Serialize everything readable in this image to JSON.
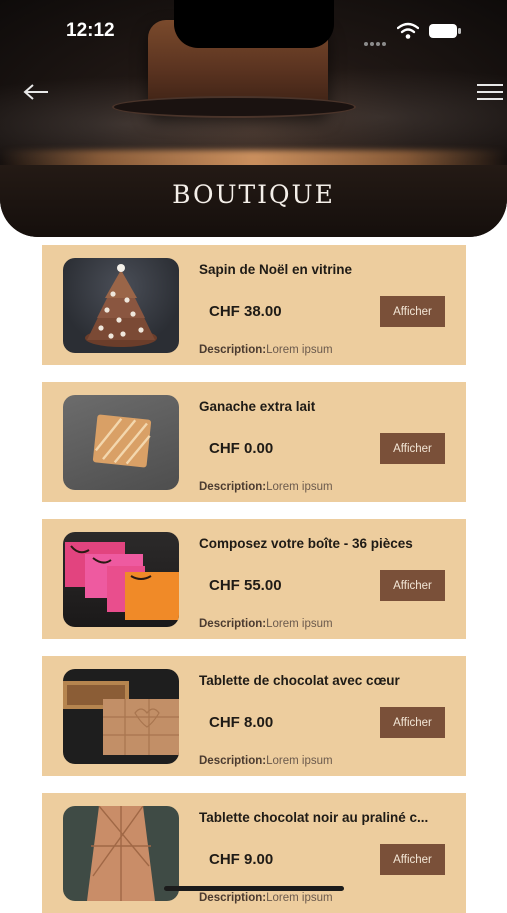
{
  "status_bar": {
    "time": "12:12"
  },
  "header": {
    "title": "BOUTIQUE"
  },
  "icons": {
    "back": "back-arrow-icon",
    "menu": "hamburger-menu-icon",
    "wifi": "wifi-icon",
    "battery": "battery-icon"
  },
  "colors": {
    "card_background": "#edcd9e",
    "button_background": "#7a5039",
    "button_text": "#f3e6d6"
  },
  "products": [
    {
      "name": "Sapin de Noël en vitrine",
      "price": "CHF 38.00",
      "button": "Afficher",
      "description_label": "Description:",
      "description_value": "Lorem ipsum"
    },
    {
      "name": "Ganache extra lait",
      "price": "CHF 0.00",
      "button": "Afficher",
      "description_label": "Description:",
      "description_value": "Lorem ipsum"
    },
    {
      "name": "Composez votre boîte - 36 pièces",
      "price": "CHF 55.00",
      "button": "Afficher",
      "description_label": "Description:",
      "description_value": "Lorem ipsum"
    },
    {
      "name": "Tablette de chocolat avec cœur",
      "price": "CHF 8.00",
      "button": "Afficher",
      "description_label": "Description:",
      "description_value": "Lorem ipsum"
    },
    {
      "name": "Tablette chocolat noir au praliné c...",
      "price": "CHF 9.00",
      "button": "Afficher",
      "description_label": "Description:",
      "description_value": "Lorem ipsum"
    }
  ]
}
